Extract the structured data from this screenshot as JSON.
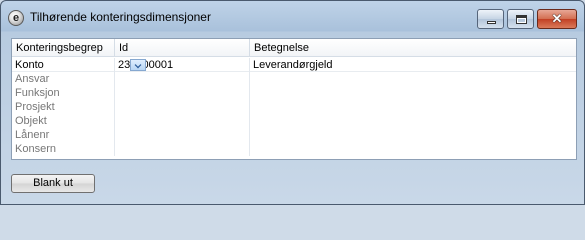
{
  "window": {
    "title": "Tilhørende konteringsdimensjoner",
    "app_icon_glyph": "e",
    "close_glyph": "✕"
  },
  "grid": {
    "columns": [
      "Konteringsbegrep",
      "Id",
      "Betegnelse"
    ],
    "rows": [
      {
        "begrep": "Konto",
        "id": "235200001",
        "betegnelse": "Leverandørgjeld",
        "active": true
      },
      {
        "begrep": "Ansvar",
        "id": "",
        "betegnelse": "",
        "active": false
      },
      {
        "begrep": "Funksjon",
        "id": "",
        "betegnelse": "",
        "active": false
      },
      {
        "begrep": "Prosjekt",
        "id": "",
        "betegnelse": "",
        "active": false
      },
      {
        "begrep": "Objekt",
        "id": "",
        "betegnelse": "",
        "active": false
      },
      {
        "begrep": "Lånenr",
        "id": "",
        "betegnelse": "",
        "active": false
      },
      {
        "begrep": "Konsern",
        "id": "",
        "betegnelse": "",
        "active": false
      }
    ]
  },
  "buttons": {
    "blank_label": "Blank ut"
  },
  "icons": {
    "app": "app-logo-icon",
    "minimize": "minimize-icon",
    "maximize": "maximize-icon",
    "close": "close-icon",
    "dropdown": "chevron-down-icon"
  }
}
